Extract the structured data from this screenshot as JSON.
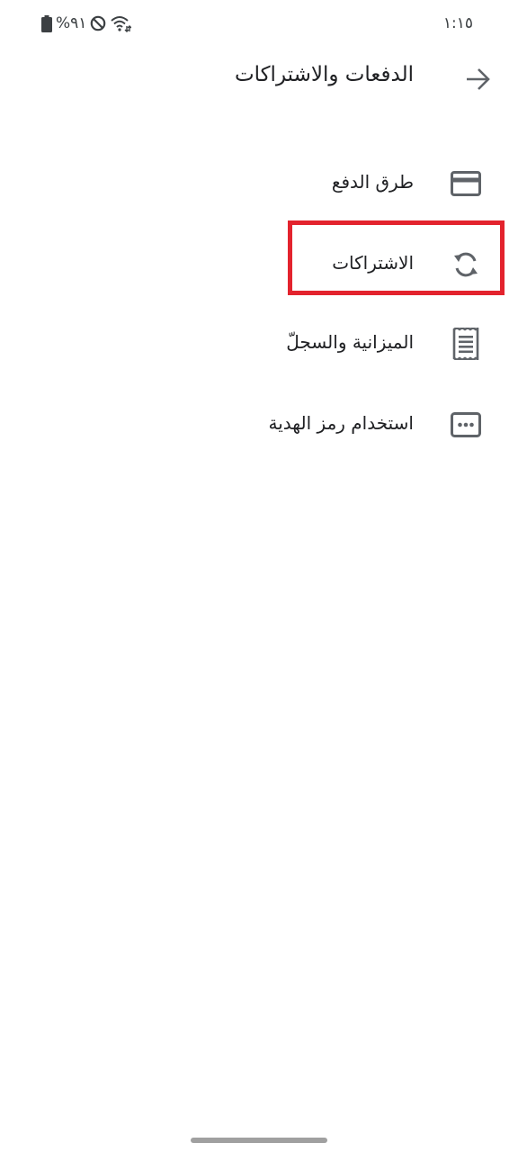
{
  "status_bar": {
    "battery_text": "%٩١",
    "time": "١:١٥"
  },
  "header": {
    "title": "الدفعات والاشتراكات",
    "back_icon": "arrow-forward-icon"
  },
  "menu": {
    "items": [
      {
        "label": "طرق الدفع",
        "icon": "credit-card-icon"
      },
      {
        "label": "الاشتراكات",
        "icon": "sync-icon",
        "highlighted": true
      },
      {
        "label": "الميزانية والسجلّ",
        "icon": "receipt-icon"
      },
      {
        "label": "استخدام رمز الهدية",
        "icon": "gift-code-icon"
      }
    ]
  },
  "colors": {
    "highlight": "#e3232d",
    "icon": "#5f6368",
    "text": "#202124"
  }
}
